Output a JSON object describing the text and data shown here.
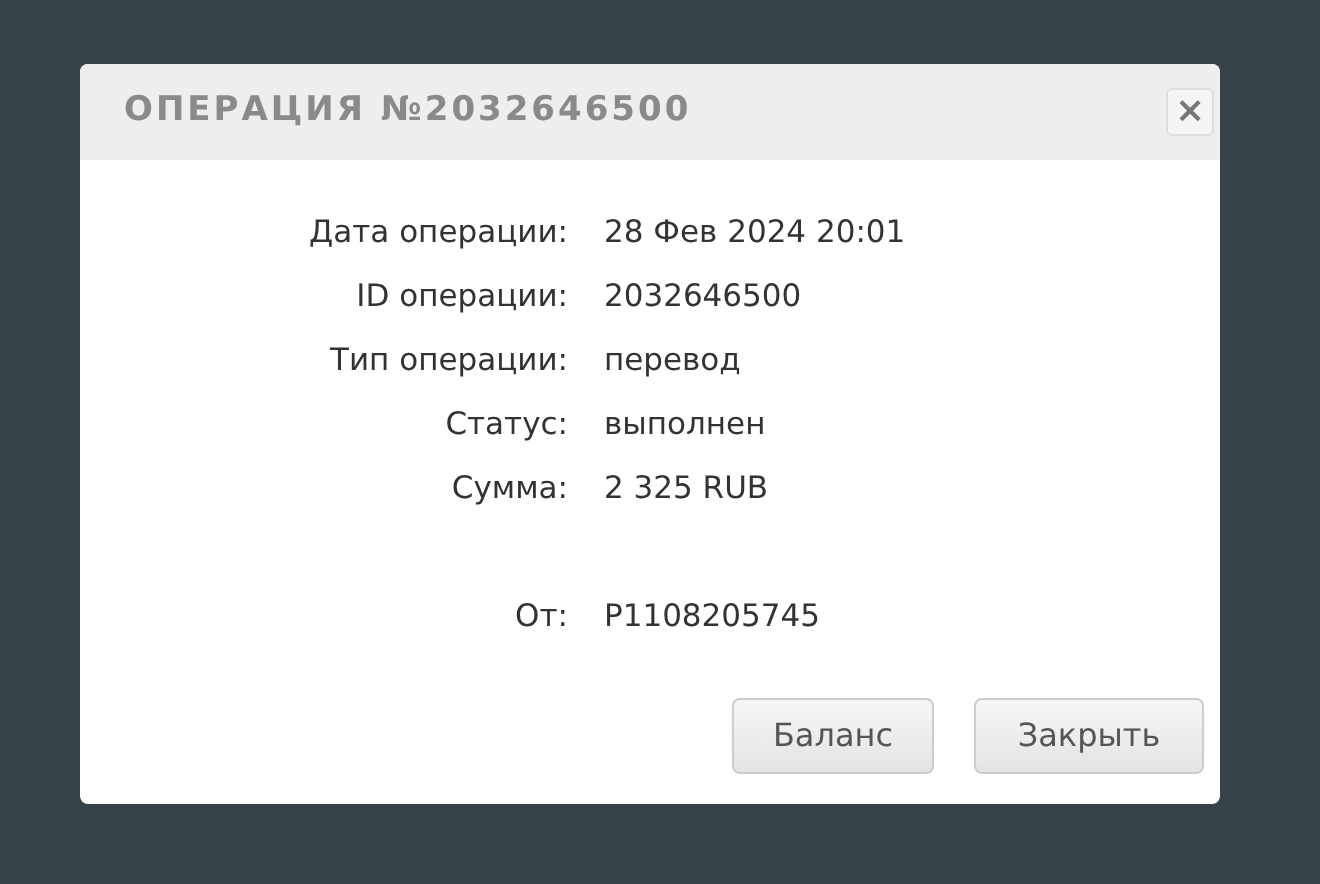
{
  "dialog": {
    "title": "ОПЕРАЦИЯ №2032646500",
    "close": "×",
    "fields": [
      {
        "label": "Дата операции:",
        "value": "28 Фев 2024 20:01"
      },
      {
        "label": "ID операции:",
        "value": "2032646500"
      },
      {
        "label": "Тип операции:",
        "value": "перевод"
      },
      {
        "label": "Статус:",
        "value": "выполнен"
      },
      {
        "label": "Сумма:",
        "value": "2 325 RUB"
      },
      {
        "label": "От:",
        "value": "P1108205745",
        "separated": true
      }
    ],
    "buttons": [
      "Баланс",
      "Закрыть"
    ]
  }
}
